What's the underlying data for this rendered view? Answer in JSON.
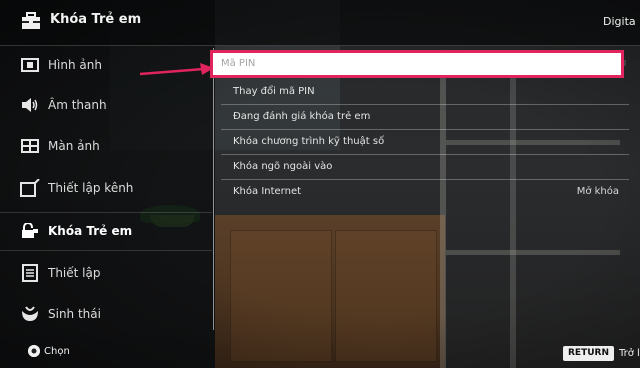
{
  "header": {
    "title": "Khóa Trẻ em",
    "source_partial": "Digita"
  },
  "sidebar": {
    "items": [
      {
        "label": "Hình ảnh",
        "icon": "picture-icon",
        "active": false
      },
      {
        "label": "Âm thanh",
        "icon": "speaker-icon",
        "active": false
      },
      {
        "label": "Màn ảnh",
        "icon": "screen-icon",
        "active": false
      },
      {
        "label": "Thiết lập kênh",
        "icon": "channel-setup-icon",
        "active": false
      },
      {
        "label": "Khóa Trẻ em",
        "icon": "lock-icon",
        "active": true
      },
      {
        "label": "Thiết lập",
        "icon": "settings-list-icon",
        "active": false
      },
      {
        "label": "Sinh thái",
        "icon": "eco-leaf-icon",
        "active": false
      }
    ]
  },
  "panel": {
    "pin": {
      "placeholder": "Mã PIN",
      "value": ""
    },
    "rows": [
      {
        "label": "Thay đổi mã PIN",
        "value": ""
      },
      {
        "label": "Đang đánh giá khóa trẻ em",
        "value": ""
      },
      {
        "label": "Khóa chương trình kỹ thuật số",
        "value": ""
      },
      {
        "label": "Khóa ngõ ngoài vào",
        "value": ""
      },
      {
        "label": "Khóa Internet",
        "value": "Mở khóa"
      }
    ]
  },
  "footer": {
    "select_label": "Chọn",
    "return_key": "RETURN",
    "return_label": "Trở lạ"
  },
  "colors": {
    "highlight_border": "#e0245e",
    "arrow": "#e0245e"
  }
}
